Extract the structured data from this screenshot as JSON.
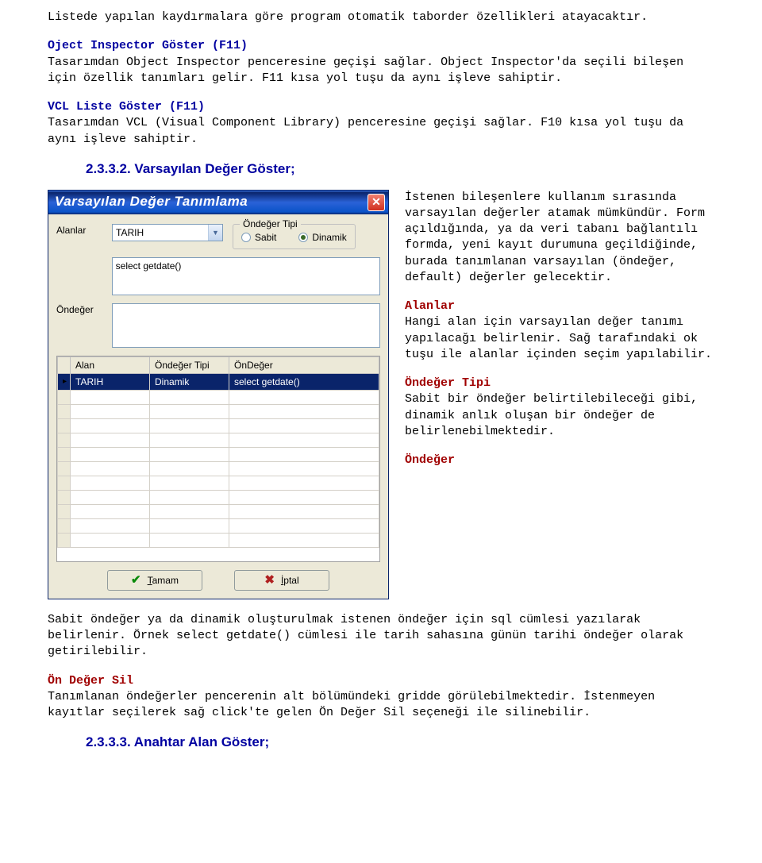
{
  "intro": "Listede yapılan kaydırmalara göre program otomatik taborder özellikleri atayacaktır.",
  "oject": {
    "title": "Oject Inspector Göster (F11)",
    "body": "Tasarımdan Object Inspector penceresine geçişi sağlar. Object Inspector'da seçili bileşen için özellik tanımları gelir. F11 kısa yol tuşu da aynı işleve sahiptir."
  },
  "vcl": {
    "title": "VCL Liste Göster (F11)",
    "body": "Tasarımdan VCL (Visual Component Library) penceresine geçişi sağlar. F10 kısa yol tuşu da aynı işleve sahiptir."
  },
  "section_2332": "2.3.3.2. Varsayılan Değer Göster;",
  "dialog": {
    "title": "Varsayılan Değer Tanımlama",
    "label_alanlar": "Alanlar",
    "combo_value": "TARIH",
    "group_label": "Öndeğer Tipi",
    "radio_sabit": "Sabit",
    "radio_dinamik": "Dinamik",
    "label_ondeger": "Öndeğer",
    "textarea_value": "select getdate()",
    "grid_headers": [
      "Alan",
      "Öndeğer Tipi",
      "ÖnDeğer"
    ],
    "grid_row": [
      "TARIH",
      "Dinamik",
      "select getdate()"
    ],
    "btn_ok": "Tamam",
    "btn_cancel": "İptal"
  },
  "desc1": "İstenen bileşenlere kullanım sırasında varsayılan değerler atamak mümkündür. Form açıldığında, ya da veri tabanı bağlantılı formda, yeni kayıt durumuna geçildiğinde, burada tanımlanan varsayılan (öndeğer, default) değerler gelecektir.",
  "alanlar_h": "Alanlar",
  "alanlar_b": "Hangi alan için varsayılan değer tanımı yapılacağı belirlenir. Sağ tarafındaki ok tuşu ile alanlar içinden seçim yapılabilir.",
  "ondtip_h": "Öndeğer Tipi",
  "ondtip_b": "Sabit bir öndeğer belirtilebileceği gibi, dinamik anlık oluşan bir öndeğer de belirlenebilmektedir.",
  "ond_h": "Öndeğer",
  "ond_b": "Sabit öndeğer ya da dinamik oluşturulmak istenen öndeğer için sql cümlesi yazılarak belirlenir. Örnek select getdate() cümlesi ile tarih sahasına günün tarihi öndeğer olarak getirilebilir.",
  "ondsil_h": "Ön Değer Sil",
  "ondsil_b": "Tanımlanan öndeğerler pencerenin alt bölümündeki gridde görülebilmektedir. İstenmeyen kayıtlar seçilerek sağ click'te gelen Ön Değer Sil seçeneği ile silinebilir.",
  "section_2333": "2.3.3.3. Anahtar Alan Göster;"
}
